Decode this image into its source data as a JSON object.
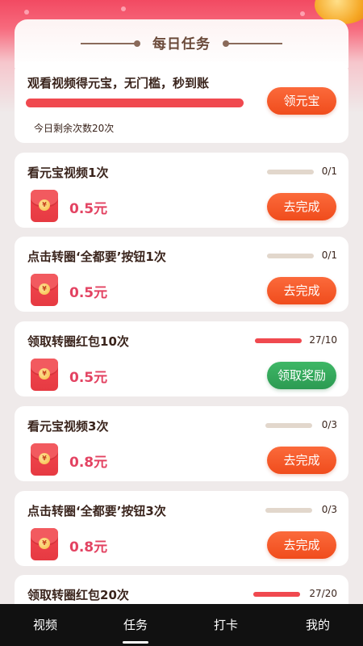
{
  "header": {
    "title": "每日任务"
  },
  "featured": {
    "title": "观看视频得元宝，无门槛，秒到账",
    "button_label": "领元宝",
    "remaining_text": "今日剩余次数20次",
    "progress": 1.0
  },
  "tasks": [
    {
      "title": "看元宝视频1次",
      "progress_text": "0/1",
      "progress": 0.0,
      "reward": "0.5元",
      "button_label": "去完成",
      "button_style": "orange"
    },
    {
      "title": "点击转圈‘全都要’按钮1次",
      "progress_text": "0/1",
      "progress": 0.0,
      "reward": "0.5元",
      "button_label": "去完成",
      "button_style": "orange"
    },
    {
      "title": "领取转圈红包10次",
      "progress_text": "27/10",
      "progress": 1.0,
      "reward": "0.5元",
      "button_label": "领取奖励",
      "button_style": "green"
    },
    {
      "title": "看元宝视频3次",
      "progress_text": "0/3",
      "progress": 0.0,
      "reward": "0.8元",
      "button_label": "去完成",
      "button_style": "orange"
    },
    {
      "title": "点击转圈‘全都要’按钮3次",
      "progress_text": "0/3",
      "progress": 0.0,
      "reward": "0.8元",
      "button_label": "去完成",
      "button_style": "orange"
    },
    {
      "title": "领取转圈红包20次",
      "progress_text": "27/20",
      "progress": 1.0
    }
  ],
  "envelope_symbol": "¥",
  "nav": {
    "items": [
      "视频",
      "任务",
      "打卡",
      "我的"
    ],
    "active": "任务"
  },
  "colors": {
    "accent_red": "#f0494f",
    "button_orange": "#f45a2b",
    "button_green": "#34a85b",
    "reward_pink": "#e34362",
    "nav_bg": "#111111"
  }
}
